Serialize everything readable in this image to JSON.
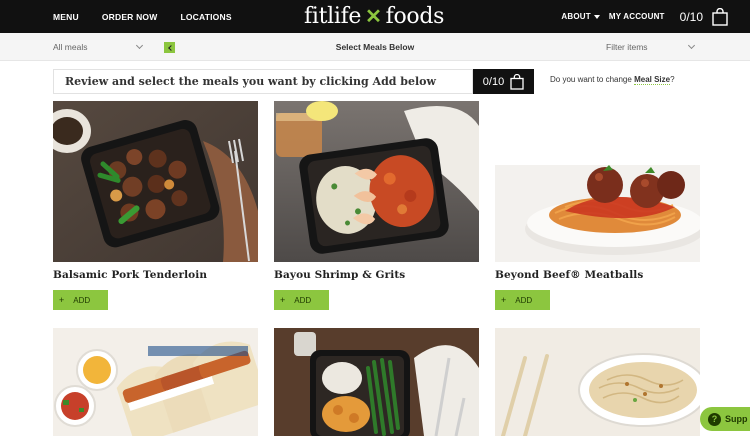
{
  "nav": {
    "left_links": [
      "MENU",
      "ORDER NOW",
      "LOCATIONS"
    ],
    "brand_left": "fitlife",
    "brand_right": "foods",
    "about": "ABOUT",
    "account": "MY ACCOUNT",
    "cart_count": "0/10"
  },
  "filters": {
    "category": "All meals",
    "title": "Select Meals Below",
    "filter": "Filter items"
  },
  "review": {
    "text": "Review and select the meals you want by clicking Add below",
    "count": "0/10",
    "question": "Do you want to change",
    "meal_size_link": "Meal Size",
    "question_end": "?"
  },
  "meals": [
    {
      "name": "Balsamic Pork Tenderloin",
      "add_label": "ADD"
    },
    {
      "name": "Bayou Shrimp & Grits",
      "add_label": "ADD"
    },
    {
      "name": "Beyond Beef® Meatballs",
      "add_label": "ADD"
    }
  ],
  "support": {
    "label": "Supp"
  },
  "colors": {
    "accent": "#8cc63f",
    "nav_bg": "#111111"
  }
}
